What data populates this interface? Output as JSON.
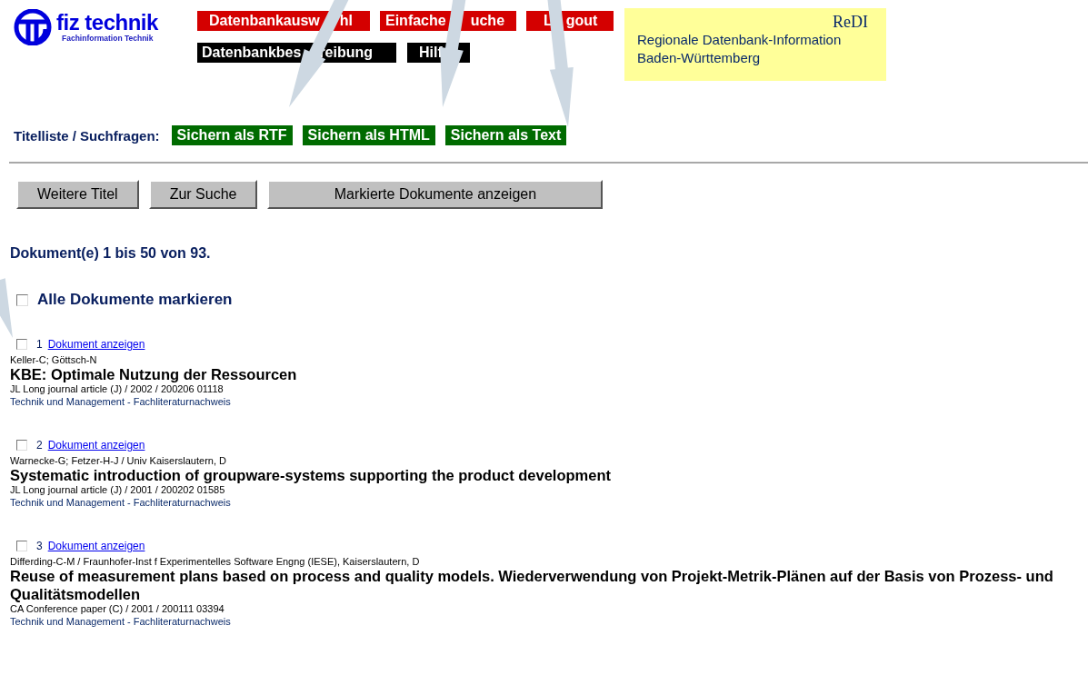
{
  "logo": {
    "name": "fiz technik",
    "tagline": "Fachinformation Technik"
  },
  "nav_top": [
    {
      "parts": [
        "Datenbankausw",
        "hl"
      ]
    },
    {
      "parts": [
        "Einfache",
        "uche"
      ]
    },
    {
      "parts": [
        "L",
        "gout"
      ]
    }
  ],
  "nav_bottom": [
    {
      "parts": [
        "Datenbankbes",
        "reibung"
      ]
    },
    {
      "parts": [
        "Hilf"
      ]
    }
  ],
  "info_box": {
    "title": "ReDI",
    "lines": [
      "Regionale Datenbank-Information",
      "Baden-Württemberg"
    ]
  },
  "save_bar": {
    "label": "Titelliste / Suchfragen:",
    "buttons": [
      "Sichern als RTF",
      "Sichern als HTML",
      "Sichern als Text"
    ]
  },
  "actions": [
    "Weitere Titel",
    "Zur Suche",
    "Markierte Dokumente anzeigen"
  ],
  "count": "Dokument(e) 1 bis 50 von 93.",
  "select_all": {
    "label": "Alle Dokumente markieren",
    "checked": false
  },
  "results": [
    {
      "number": "1",
      "link": "Dokument anzeigen",
      "checked": false,
      "authors": "Keller-C; Göttsch-N",
      "title": "KBE: Optimale Nutzung der Ressourcen",
      "meta": "JL Long journal article (J) / 2002 / 200206 01118",
      "source": "Technik und Management - Fachliteraturnachweis"
    },
    {
      "number": "2",
      "link": "Dokument anzeigen",
      "checked": false,
      "authors": "Warnecke-G; Fetzer-H-J / Univ Kaiserslautern, D",
      "title": "Systematic introduction of groupware-systems supporting the product development",
      "meta": "JL Long journal article (J) / 2001 / 200202 01585",
      "source": "Technik und Management - Fachliteraturnachweis"
    },
    {
      "number": "3",
      "link": "Dokument anzeigen",
      "checked": false,
      "authors": "Differding-C-M / Fraunhofer-Inst f Experimentelles Software Engng (IESE), Kaiserslautern, D",
      "title": "Reuse of measurement plans based on process and quality models. Wiederverwendung von Projekt-Metrik-Plänen auf der Basis von Prozess- und Qualitätsmodellen",
      "meta": "CA Conference paper (C) / 2001 / 200111 03394",
      "source": "Technik und Management - Fachliteraturnachweis"
    }
  ]
}
